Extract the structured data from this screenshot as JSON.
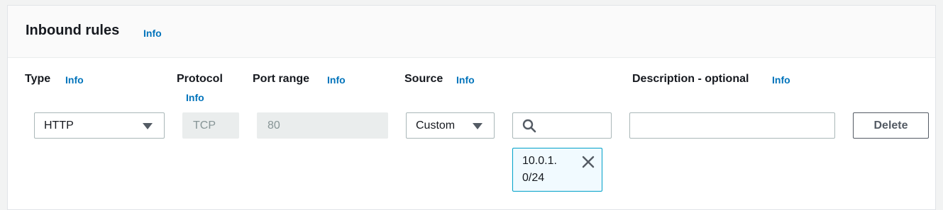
{
  "section": {
    "title": "Inbound rules",
    "info": "Info"
  },
  "columns": {
    "type": {
      "label": "Type",
      "info": "Info"
    },
    "protocol": {
      "label": "Protocol",
      "info": "Info"
    },
    "port_range": {
      "label": "Port range",
      "info": "Info"
    },
    "source": {
      "label": "Source",
      "info": "Info"
    },
    "description": {
      "label": "Description - optional",
      "info": "Info"
    }
  },
  "rule": {
    "type": "HTTP",
    "protocol": "TCP",
    "port_range": "80",
    "source_mode": "Custom",
    "source_search": "",
    "source_token_line1": "10.0.1.",
    "source_token_line2": "0/24",
    "description": "",
    "delete_label": "Delete"
  },
  "icons": {
    "type_dropdown": "caret-down-icon",
    "source_dropdown": "caret-down-icon",
    "search": "search-icon",
    "remove_token": "close-icon"
  },
  "colors": {
    "info_link": "#0073bb",
    "token_border": "#00a1c9",
    "token_bg": "#f1faff",
    "disabled_bg": "#eaeded"
  }
}
